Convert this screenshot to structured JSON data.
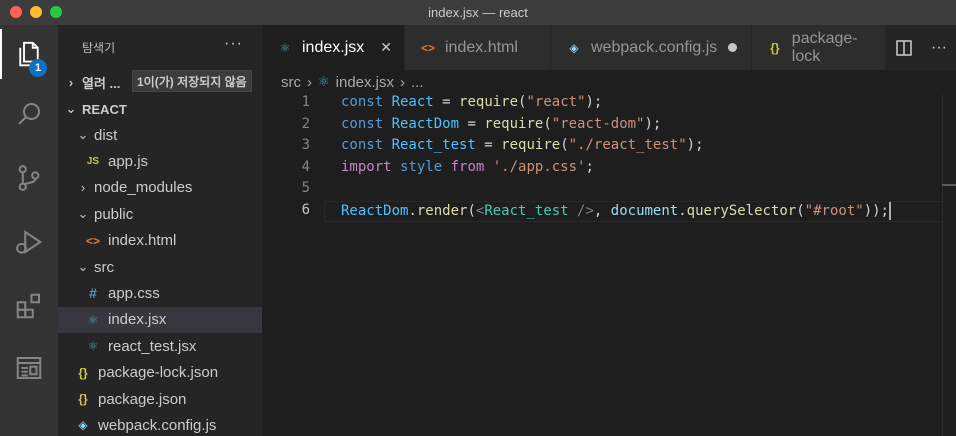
{
  "window": {
    "title": "index.jsx — react"
  },
  "activity": {
    "explorer_badge": "1"
  },
  "sidebar": {
    "header": "탐색기",
    "more_label": "···",
    "open_editors": {
      "label": "열려 ...",
      "tooltip": "1이(가) 저장되지 않음"
    },
    "project": "REACT",
    "tree": [
      {
        "label": "dist",
        "kind": "folder-open",
        "depth": 1
      },
      {
        "label": "app.js",
        "kind": "js",
        "depth": 2
      },
      {
        "label": "node_modules",
        "kind": "folder-closed",
        "depth": 1
      },
      {
        "label": "public",
        "kind": "folder-open",
        "depth": 1
      },
      {
        "label": "index.html",
        "kind": "html",
        "depth": 2
      },
      {
        "label": "src",
        "kind": "folder-open",
        "depth": 1
      },
      {
        "label": "app.css",
        "kind": "css",
        "depth": 2
      },
      {
        "label": "index.jsx",
        "kind": "react",
        "depth": 2,
        "selected": true
      },
      {
        "label": "react_test.jsx",
        "kind": "react",
        "depth": 2
      },
      {
        "label": "package-lock.json",
        "kind": "json",
        "depth": 1
      },
      {
        "label": "package.json",
        "kind": "json",
        "depth": 1
      },
      {
        "label": "webpack.config.js",
        "kind": "webpack",
        "depth": 1
      }
    ]
  },
  "tabs": [
    {
      "label": "index.jsx",
      "active": true,
      "icon": "react-icon"
    },
    {
      "label": "index.html",
      "active": false,
      "icon": "html-icon"
    },
    {
      "label": "webpack.config.js",
      "active": false,
      "icon": "webpack-icon",
      "dirty": true
    },
    {
      "label": "package-lock",
      "active": false,
      "icon": "json-icon"
    }
  ],
  "breadcrumb": {
    "folder": "src",
    "file": "index.jsx",
    "rest": "..."
  },
  "editor": {
    "line_numbers": [
      "1",
      "2",
      "3",
      "4",
      "5",
      "6"
    ],
    "current_line": "6",
    "lines": [
      [
        [
          "kw",
          "const "
        ],
        [
          "var",
          "React"
        ],
        [
          "plain",
          " = "
        ],
        [
          "fn",
          "require"
        ],
        [
          "plain",
          "("
        ],
        [
          "str",
          "\"react\""
        ],
        [
          "plain",
          ");"
        ]
      ],
      [
        [
          "kw",
          "const "
        ],
        [
          "var",
          "ReactDom"
        ],
        [
          "plain",
          " = "
        ],
        [
          "fn",
          "require"
        ],
        [
          "plain",
          "("
        ],
        [
          "str",
          "\"react-dom\""
        ],
        [
          "plain",
          ");"
        ]
      ],
      [
        [
          "kw",
          "const "
        ],
        [
          "var",
          "React_test"
        ],
        [
          "plain",
          " = "
        ],
        [
          "fn",
          "require"
        ],
        [
          "plain",
          "("
        ],
        [
          "str",
          "\"./react_test\""
        ],
        [
          "plain",
          ");"
        ]
      ],
      [
        [
          "imp",
          "import "
        ],
        [
          "kw",
          "style "
        ],
        [
          "imp",
          "from "
        ],
        [
          "str",
          "'./app.css'"
        ],
        [
          "plain",
          ";"
        ]
      ],
      [],
      [
        [
          "var",
          "ReactDom"
        ],
        [
          "plain",
          "."
        ],
        [
          "fn",
          "render"
        ],
        [
          "plain",
          "("
        ],
        [
          "tagp",
          "<"
        ],
        [
          "tag",
          "React_test"
        ],
        [
          "tagp",
          " />"
        ],
        [
          "plain",
          ", "
        ],
        [
          "prop",
          "document"
        ],
        [
          "plain",
          "."
        ],
        [
          "fn",
          "querySelector"
        ],
        [
          "plain",
          "("
        ],
        [
          "str",
          "\"#root\""
        ],
        [
          "plain",
          "));"
        ]
      ]
    ]
  }
}
